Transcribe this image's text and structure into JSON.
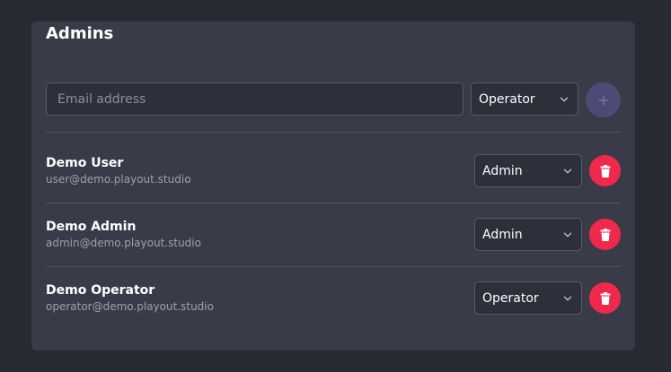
{
  "section": {
    "title": "Admins"
  },
  "add_form": {
    "email_placeholder": "Email address",
    "email_value": "",
    "role_selected": "Operator",
    "add_icon": "plus-icon"
  },
  "users": [
    {
      "name": "Demo User",
      "email": "user@demo.playout.studio",
      "role": "Admin"
    },
    {
      "name": "Demo Admin",
      "email": "admin@demo.playout.studio",
      "role": "Admin"
    },
    {
      "name": "Demo Operator",
      "email": "operator@demo.playout.studio",
      "role": "Operator"
    }
  ],
  "icons": {
    "dropdown": "chevron-down-icon",
    "delete": "trash-icon"
  },
  "colors": {
    "panel": "#393c48",
    "background": "#262a33",
    "delete_button": "#f0294c",
    "add_button": "#4d4a76"
  }
}
